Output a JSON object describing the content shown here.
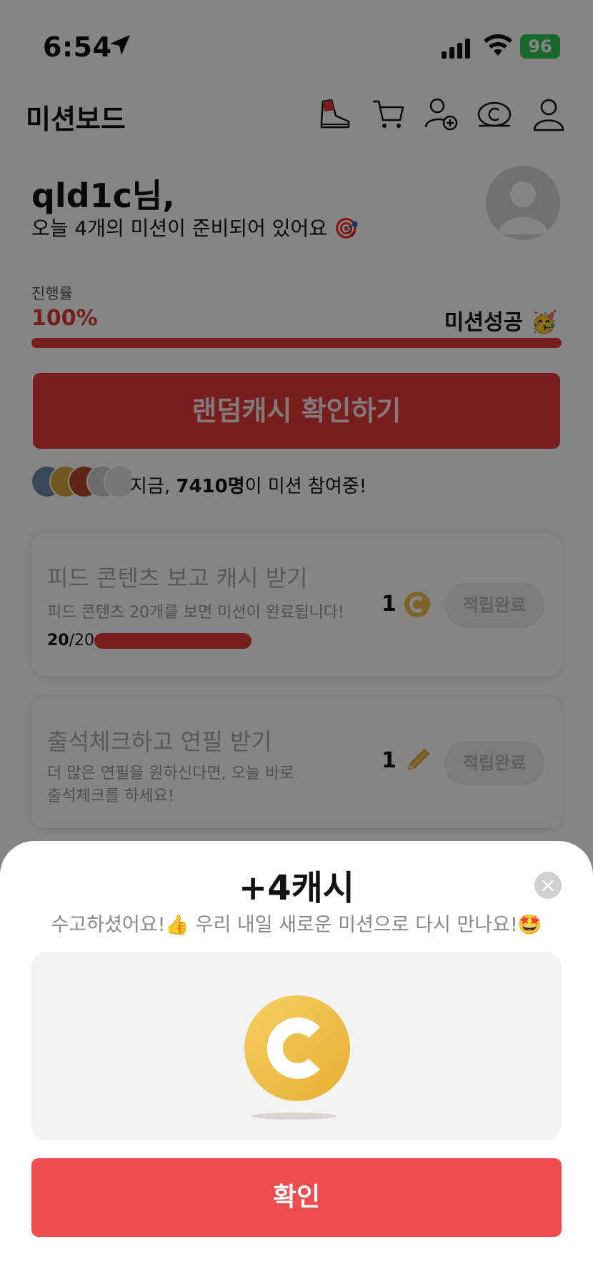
{
  "status_bar": {
    "time": "6:54",
    "battery": "96"
  },
  "header": {
    "title": "미션보드"
  },
  "greeting": {
    "username": "qld1c님,",
    "subtitle": "오늘 4개의 미션이 준비되어 있어요 🎯"
  },
  "progress": {
    "label": "진행률",
    "value": "100%",
    "status": "미션성공 🥳",
    "fraction": 1.0
  },
  "random_cash_button": "랜덤캐시 확인하기",
  "participants": {
    "prefix": "지금, ",
    "count": "7410명",
    "suffix": "이 미션 참여중!"
  },
  "missions": [
    {
      "title": "피드 콘텐츠 보고 캐시 받기",
      "description": "피드 콘텐츠 20개를 보면 미션이 완료됩니다!",
      "progress_done": "20",
      "progress_total": "/20",
      "reward": "1",
      "reward_icon": "coin-icon",
      "button": "적립완료"
    },
    {
      "title": "출석체크하고 연필 받기",
      "description_line1": "더 많은 연필을 원하신다면, 오늘 바로",
      "description_line2": "출석체크를 하세요!",
      "reward": "1",
      "reward_icon": "pencil-icon",
      "button": "적립완료"
    }
  ],
  "sheet": {
    "title": "+4캐시",
    "message": "수고하셨어요!👍 우리 내일 새로운 미션으로 다시 만나요!🤩",
    "close_symbol": "×",
    "confirm": "확인"
  },
  "colors": {
    "accent": "#ee4c4f",
    "progress": "#e8393b",
    "coin": "#f0c04b"
  }
}
